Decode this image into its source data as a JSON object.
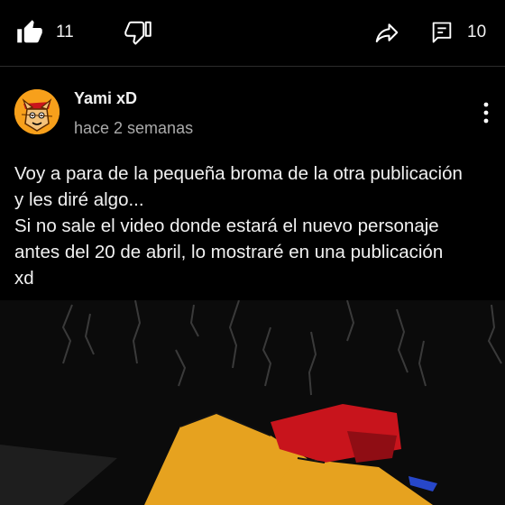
{
  "actions": {
    "like_count": "11",
    "comment_count": "10"
  },
  "post": {
    "author": "Yami xD",
    "time": "hace 2 semanas",
    "text_lines": [
      "Voy a para de la pequeña broma de la otra publicación",
      "y les diré algo...",
      "Si no sale el video donde estará el nuevo personaje",
      "antes del 20 de abril, lo mostraré en una publicación",
      "xd"
    ]
  },
  "icons": {
    "like": "thumbs-up-icon",
    "dislike": "thumbs-down-icon",
    "share": "share-arrow-icon",
    "comments": "comment-icon",
    "menu": "more-vertical-icon"
  },
  "colors": {
    "background": "#000000",
    "text_primary": "#f1f1f1",
    "text_secondary": "#aaaaaa",
    "avatar_orange": "#f7a01b",
    "art_yellow": "#e6a21f",
    "art_red": "#c8141c",
    "art_blue": "#2747c9"
  }
}
